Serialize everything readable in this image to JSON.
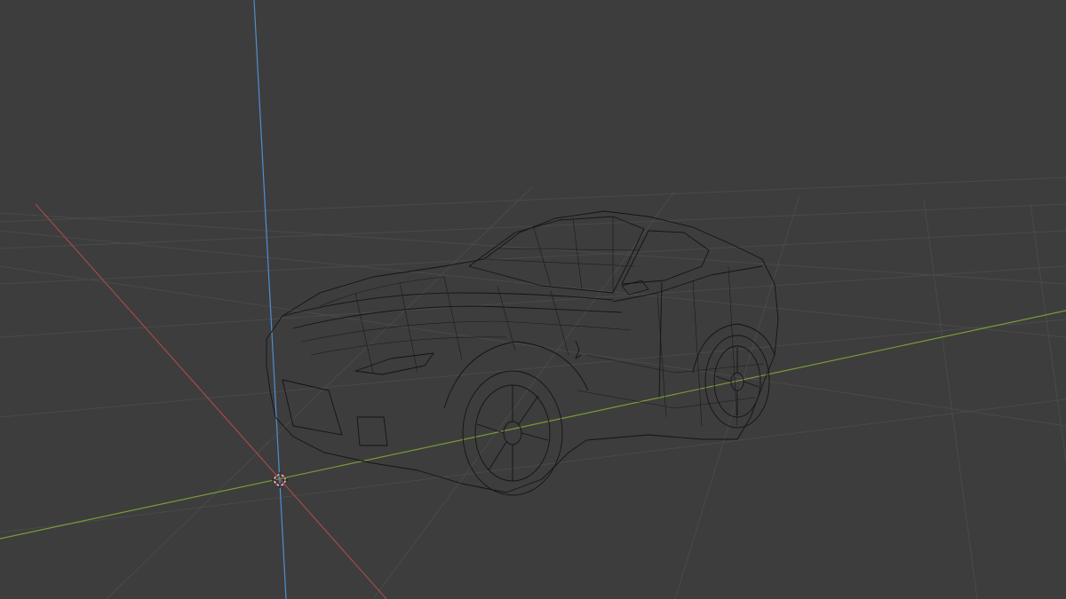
{
  "viewport": {
    "background_color": "#3d3d3d",
    "grid_color": "#4a4a4a",
    "axis_colors": {
      "x": "#a34a4a",
      "y": "#7a9a3a",
      "z": "#4f8fd0"
    },
    "icons": {
      "cursor": "3d-cursor-icon"
    }
  },
  "model": {
    "shading": "wireframe",
    "wire_color": "#141414",
    "body_color": "#2a2a2a"
  }
}
